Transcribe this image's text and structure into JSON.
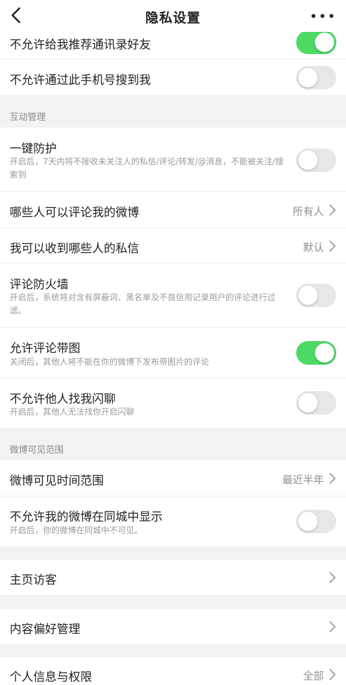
{
  "nav": {
    "title": "隐私设置",
    "back_icon": "chevron-left-icon",
    "more_icon": "ellipsis-icon"
  },
  "colors": {
    "switch_on": "#4cd964",
    "switch_off": "#e7e7e7",
    "section_bg": "#f2f2f2"
  },
  "rows": {
    "recommend_contacts": {
      "label": "不允许给我推荐通讯录好友",
      "on": true
    },
    "search_by_phone": {
      "label": "不允许通过此手机号搜到我",
      "on": false
    },
    "section_interaction": "互动管理",
    "one_key_protect": {
      "label": "一键防护",
      "desc": "开启后，7天内将不接收未关注人的私信/评论/转发/@消息，不能被关注/搜索到",
      "on": false
    },
    "who_comment": {
      "label": "哪些人可以评论我的微博",
      "value": "所有人"
    },
    "who_message": {
      "label": "我可以收到哪些人的私信",
      "value": "默认"
    },
    "comment_firewall": {
      "label": "评论防火墙",
      "desc": "开启后，系统将对含有屏蔽词、黑名单及不良信用记录用户的评论进行过滤。",
      "on": false
    },
    "comment_images": {
      "label": "允许评论带图",
      "desc": "关闭后，其他人将不能在你的微博下发布带图片的评论",
      "on": true
    },
    "flash_chat": {
      "label": "不允许他人找我闪聊",
      "desc": "开启后，其他人无法找你开启闪聊",
      "on": false
    },
    "section_visibility": "微博可见范围",
    "visible_time": {
      "label": "微博可见时间范围",
      "value": "最近半年"
    },
    "same_city": {
      "label": "不允许我的微博在同城中显示",
      "desc": "开启后，你的微博在同城中不可见。",
      "on": false
    },
    "visitors": {
      "label": "主页访客"
    },
    "content_pref": {
      "label": "内容偏好管理"
    },
    "personal_info": {
      "label": "个人信息与权限",
      "value": "全部"
    }
  }
}
